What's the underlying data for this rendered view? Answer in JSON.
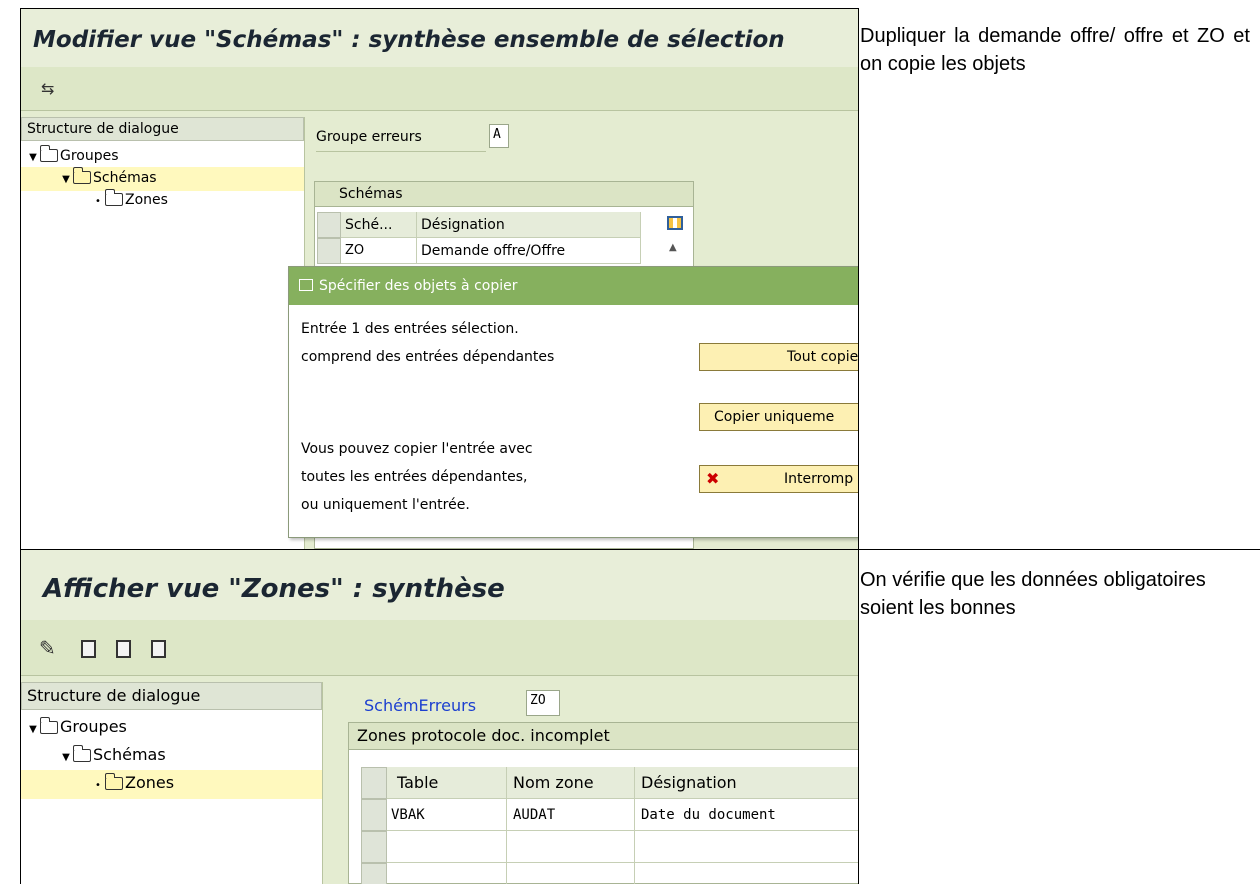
{
  "row1": {
    "note": "Dupliquer la demande offre/ offre et ZO et on copie les objets",
    "sap": {
      "title": "Modifier vue \"Schémas\" : synthèse ensemble de sélection",
      "tree": {
        "header": "Structure de dialogue",
        "items": [
          {
            "label": "Groupes",
            "level": 0,
            "selected": false
          },
          {
            "label": "Schémas",
            "level": 1,
            "selected": true
          },
          {
            "label": "Zones",
            "level": 2,
            "selected": false
          }
        ]
      },
      "field": {
        "label": "Groupe erreurs",
        "value": "A"
      },
      "table": {
        "title": "Schémas",
        "columns": [
          "Sché...",
          "Désignation"
        ],
        "rows": [
          [
            "ZO",
            "Demande offre/Offre"
          ]
        ]
      },
      "dialog": {
        "title": "Spécifier des objets à copier",
        "lines": [
          "Entrée  1  des entrées sélection.",
          "comprend des entrées dépendantes",
          "Vous pouvez copier l'entrée avec",
          "toutes les entrées dépendantes,",
          "ou uniquement l'entrée."
        ],
        "buttons": {
          "copy_all": "Tout copier",
          "copy_only": "Copier uniqueme",
          "cancel": "Interromp"
        }
      }
    }
  },
  "row2": {
    "note": "On vérifie que les données obligatoires soient les bonnes",
    "sap": {
      "title": "Afficher vue \"Zones\" : synthèse",
      "tree": {
        "header": "Structure de dialogue",
        "items": [
          {
            "label": "Groupes",
            "level": 0,
            "selected": false
          },
          {
            "label": "Schémas",
            "level": 1,
            "selected": false
          },
          {
            "label": "Zones",
            "level": 2,
            "selected": true
          }
        ]
      },
      "field": {
        "label": "SchémErreurs",
        "value": "ZO"
      },
      "table": {
        "title": "Zones protocole doc. incomplet",
        "columns": [
          "Table",
          "Nom zone",
          "Désignation"
        ],
        "rows": [
          [
            "VBAK",
            "AUDAT",
            "Date du document"
          ]
        ]
      }
    }
  }
}
